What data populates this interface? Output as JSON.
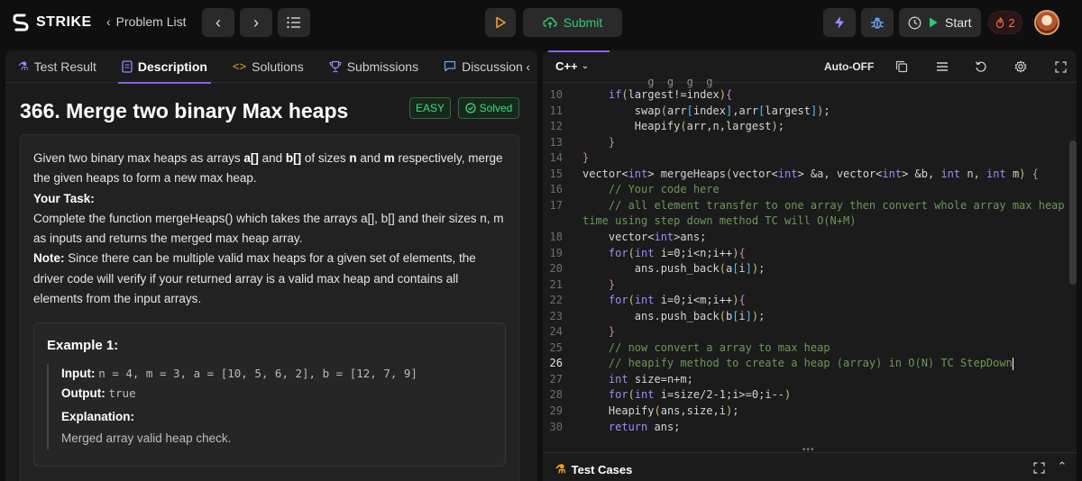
{
  "header": {
    "brand": "STRIKE",
    "problem_list": "Problem List",
    "submit_label": "Submit",
    "start_label": "Start",
    "streak_count": "2"
  },
  "tabs": [
    {
      "label": "Test Result",
      "icon": "flask-icon"
    },
    {
      "label": "Description",
      "icon": "document-icon"
    },
    {
      "label": "Solutions",
      "icon": "code-icon"
    },
    {
      "label": "Submissions",
      "icon": "trophy-icon"
    },
    {
      "label": "Discussion",
      "icon": "chat-icon"
    }
  ],
  "problem": {
    "title": "366. Merge two binary Max heaps",
    "difficulty": "EASY",
    "status": "Solved",
    "p1a": "Given two binary max heaps as arrays ",
    "p1b": "a[]",
    "p1c": " and ",
    "p1d": "b[]",
    "p1e": " of sizes ",
    "p1f": "n",
    "p1g": " and ",
    "p1h": "m",
    "p1i": " respectively, merge the given heaps to form a new max heap.",
    "task_heading": "Your Task:",
    "task_text": "Complete the function mergeHeaps() which takes the arrays a[], b[] and their sizes n, m as inputs and returns the merged max heap array.",
    "note_heading": "Note:",
    "note_text": " Since there can be multiple valid max heaps for a given set of elements, the driver code will verify if your returned array is a valid max heap and contains all elements from the input arrays.",
    "example_title": "Example 1:",
    "input_label": "Input:",
    "input_value": "n = 4, m = 3, a = [10, 5, 6, 2], b = [12, 7, 9]",
    "output_label": "Output:",
    "output_value": "true",
    "explanation_label": "Explanation:",
    "explanation_text": "Merged array valid heap check."
  },
  "editor": {
    "language": "C++",
    "autocomplete": "Auto-OFF",
    "test_cases": "Test Cases",
    "cursor_line": 26,
    "lines": [
      {
        "n": "10",
        "t": "    if(largest!=index){"
      },
      {
        "n": "11",
        "t": "        swap(arr[index],arr[largest]);"
      },
      {
        "n": "12",
        "t": "        Heapify(arr,n,largest);"
      },
      {
        "n": "13",
        "t": "    }"
      },
      {
        "n": "14",
        "t": "}"
      },
      {
        "n": "15",
        "t": "vector<int> mergeHeaps(vector<int> &a, vector<int> &b, int n, int m) {"
      },
      {
        "n": "16",
        "t": "    // Your code here"
      },
      {
        "n": "17",
        "t": "    // all element transfer to one array then convert whole array max heap one"
      },
      {
        "n": "",
        "t": "time using step down method TC will O(N+M)"
      },
      {
        "n": "18",
        "t": "    vector<int>ans;"
      },
      {
        "n": "19",
        "t": "    for(int i=0;i<n;i++){"
      },
      {
        "n": "20",
        "t": "        ans.push_back(a[i]);"
      },
      {
        "n": "21",
        "t": "    }"
      },
      {
        "n": "22",
        "t": "    for(int i=0;i<m;i++){"
      },
      {
        "n": "23",
        "t": "        ans.push_back(b[i]);"
      },
      {
        "n": "24",
        "t": "    }"
      },
      {
        "n": "25",
        "t": "    // now convert a array to max heap"
      },
      {
        "n": "26",
        "t": "    // heapify method to create a heap (array) in O(N) TC StepDown"
      },
      {
        "n": "27",
        "t": "    int size=n+m;"
      },
      {
        "n": "28",
        "t": "    for(int i=size/2-1;i>=0;i--)"
      },
      {
        "n": "29",
        "t": "    Heapify(ans,size,i);"
      },
      {
        "n": "30",
        "t": "    return ans;"
      }
    ]
  }
}
